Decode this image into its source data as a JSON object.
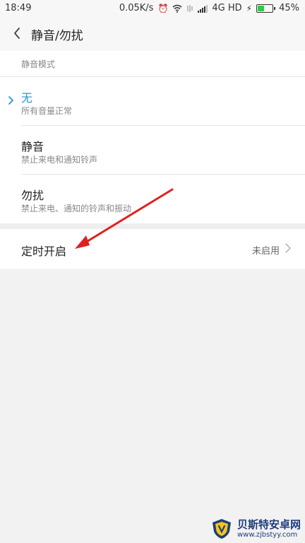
{
  "status_bar": {
    "time": "18:49",
    "net_speed": "0.05K/s",
    "network": "4G HD",
    "battery_percent": "45%",
    "battery_level": 0.45
  },
  "header": {
    "title": "静音/勿扰",
    "back_icon": "chevron-left-icon"
  },
  "mode_section": {
    "label": "静音模式",
    "selected_index": 0,
    "options": [
      {
        "title": "无",
        "subtitle": "所有音量正常"
      },
      {
        "title": "静音",
        "subtitle": "禁止来电和通知铃声"
      },
      {
        "title": "勿扰",
        "subtitle": "禁止来电、通知的铃声和振动"
      }
    ]
  },
  "timer": {
    "label": "定时开启",
    "value": "未启用"
  },
  "watermark": {
    "name": "贝斯特安卓网",
    "url": "www.zjbstyy.com"
  },
  "colors": {
    "accent": "#2196d9",
    "annotation_arrow": "#e02020"
  }
}
